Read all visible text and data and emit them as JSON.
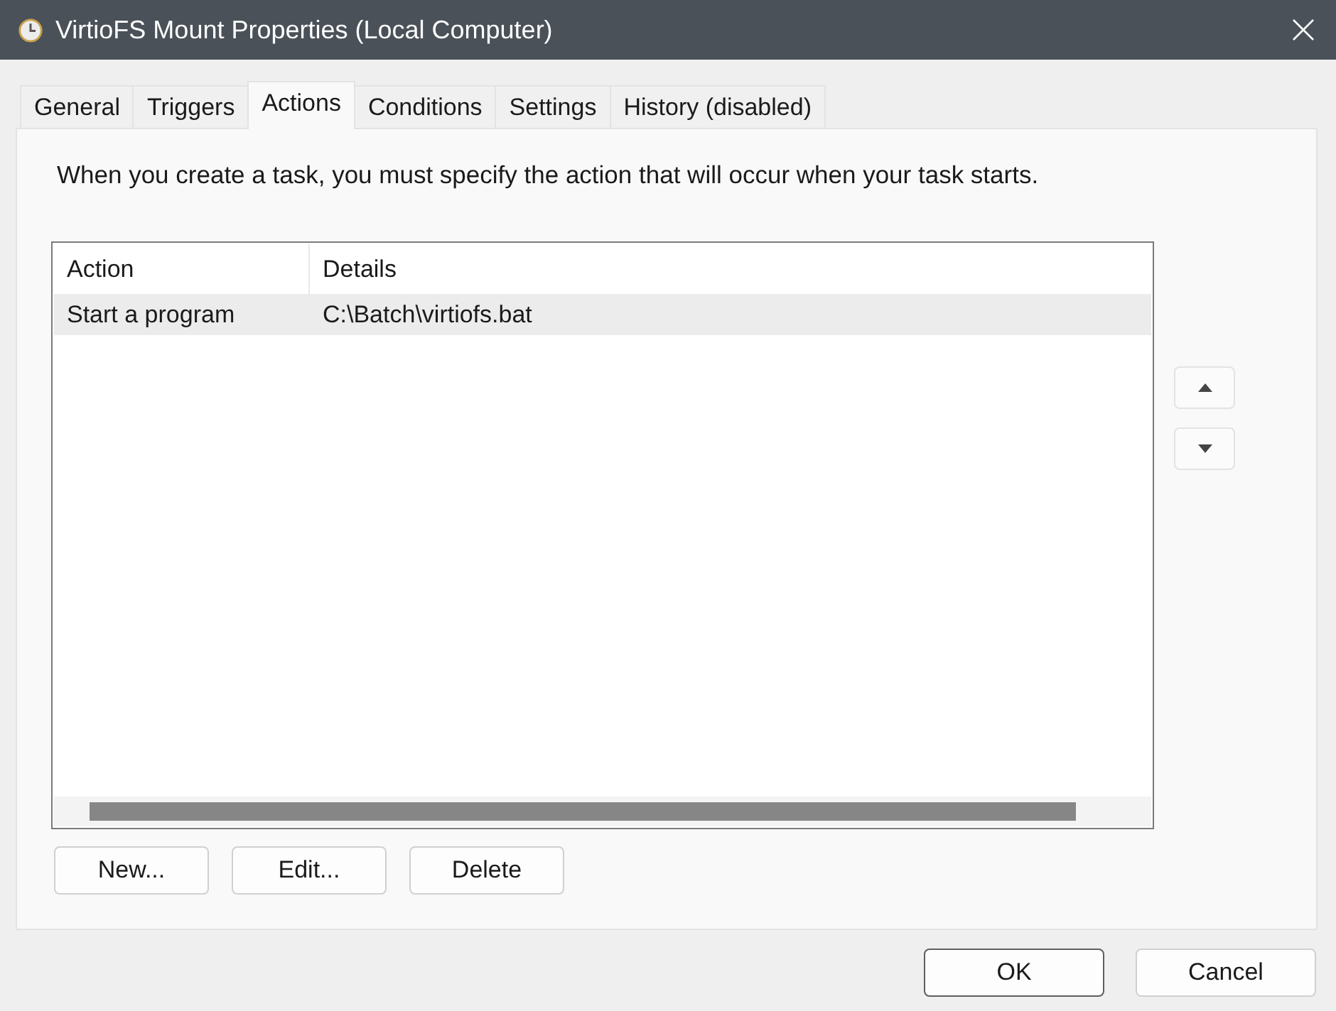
{
  "window": {
    "title": "VirtioFS Mount Properties (Local Computer)"
  },
  "tabs": [
    {
      "label": "General",
      "selected": false
    },
    {
      "label": "Triggers",
      "selected": false
    },
    {
      "label": "Actions",
      "selected": true
    },
    {
      "label": "Conditions",
      "selected": false
    },
    {
      "label": "Settings",
      "selected": false
    },
    {
      "label": "History (disabled)",
      "selected": false
    }
  ],
  "description": "When you create a task, you must specify the action that will occur when your task starts.",
  "actions_list": {
    "columns": [
      "Action",
      "Details"
    ],
    "rows": [
      {
        "cells": [
          "Start a program",
          "C:\\Batch\\virtiofs.bat"
        ],
        "selected": true
      }
    ]
  },
  "list_buttons": [
    "New...",
    "Edit...",
    "Delete"
  ],
  "dialog_buttons": [
    {
      "label": "OK",
      "default": true
    },
    {
      "label": "Cancel",
      "default": false
    }
  ]
}
